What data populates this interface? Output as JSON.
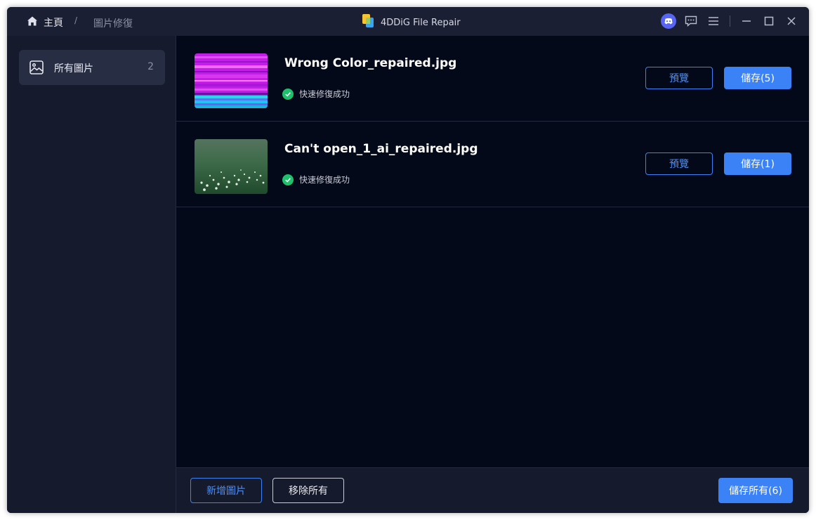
{
  "titlebar": {
    "home_label": "主頁",
    "separator": "/",
    "current_page": "圖片修復",
    "app_title": "4DDiG File Repair"
  },
  "sidebar": {
    "items": [
      {
        "label": "所有圖片",
        "count": "2",
        "icon": "image-icon"
      }
    ]
  },
  "files": [
    {
      "name": "Wrong Color_repaired.jpg",
      "status": "快速修復成功",
      "preview_label": "預覽",
      "save_label": "儲存(5)",
      "thumbnail": "glitched-pink-cyan-image"
    },
    {
      "name": "Can't open_1_ai_repaired.jpg",
      "status": "快速修復成功",
      "preview_label": "預覽",
      "save_label": "儲存(1)",
      "thumbnail": "flower-meadow-image"
    }
  ],
  "footer": {
    "add_label": "新增圖片",
    "remove_all_label": "移除所有",
    "save_all_label": "儲存所有(6)"
  },
  "colors": {
    "accent": "#3b82f6",
    "success": "#1ec06b",
    "background": "#040919",
    "panel": "#151a2c"
  }
}
